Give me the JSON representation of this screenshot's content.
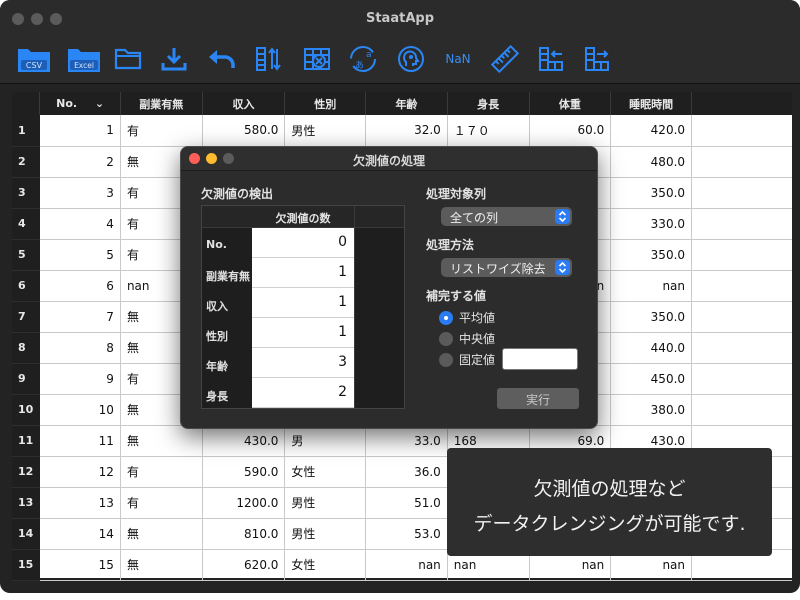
{
  "app": {
    "title": "StaatApp"
  },
  "toolbar": {
    "csv_label": "CSV",
    "excel_label": "Excel",
    "nan_label": "NaN",
    "accent": "#2b86f5"
  },
  "table": {
    "columns": [
      "No.",
      "副業有無",
      "収入",
      "性別",
      "年齢",
      "身長",
      "体重",
      "睡眠時間"
    ],
    "rows": [
      [
        "1",
        "1",
        "有",
        "580.0",
        "男性",
        "32.0",
        "１７０",
        "60.0",
        "420.0"
      ],
      [
        "2",
        "2",
        "無",
        "",
        "",
        "",
        "",
        "",
        "480.0"
      ],
      [
        "3",
        "3",
        "有",
        "",
        "",
        "",
        "",
        "",
        "350.0"
      ],
      [
        "4",
        "4",
        "有",
        "",
        "",
        "",
        "",
        "",
        "330.0"
      ],
      [
        "5",
        "5",
        "有",
        "",
        "",
        "",
        "",
        "",
        "350.0"
      ],
      [
        "6",
        "6",
        "nan",
        "",
        "",
        "",
        "",
        "n",
        "nan"
      ],
      [
        "7",
        "7",
        "無",
        "",
        "",
        "",
        "",
        "",
        "350.0"
      ],
      [
        "8",
        "8",
        "無",
        "",
        "",
        "",
        "",
        "",
        "440.0"
      ],
      [
        "9",
        "9",
        "有",
        "",
        "",
        "",
        "",
        "",
        "450.0"
      ],
      [
        "10",
        "10",
        "無",
        "",
        "",
        "",
        "",
        "",
        "380.0"
      ],
      [
        "11",
        "11",
        "無",
        "430.0",
        "男",
        "33.0",
        "168",
        "69.0",
        "430.0"
      ],
      [
        "12",
        "12",
        "有",
        "590.0",
        "女性",
        "36.0",
        "",
        "",
        ""
      ],
      [
        "13",
        "13",
        "有",
        "1200.0",
        "男性",
        "51.0",
        "",
        "",
        ""
      ],
      [
        "14",
        "14",
        "無",
        "810.0",
        "男性",
        "53.0",
        "",
        "",
        ""
      ],
      [
        "15",
        "15",
        "無",
        "620.0",
        "女性",
        "nan",
        "nan",
        "nan",
        "nan"
      ]
    ]
  },
  "dialog": {
    "title": "欠測値の処理",
    "detect_label": "欠測値の検出",
    "count_header": "欠測値の数",
    "missing": [
      {
        "label": "No.",
        "count": "0"
      },
      {
        "label": "副業有無",
        "count": "1"
      },
      {
        "label": "収入",
        "count": "1"
      },
      {
        "label": "性別",
        "count": "1"
      },
      {
        "label": "年齢",
        "count": "3"
      },
      {
        "label": "身長",
        "count": "2"
      }
    ],
    "target_label": "処理対象列",
    "target_value": "全ての列",
    "method_label": "処理方法",
    "method_value": "リストワイズ除去",
    "fill_label": "補完する値",
    "fill_options": [
      "平均値",
      "中央値",
      "固定値"
    ],
    "fill_selected": "平均値",
    "fixed_value": "",
    "run_label": "実行"
  },
  "caption": {
    "line1": "欠測値の処理など",
    "line2": "データクレンジングが可能です."
  }
}
